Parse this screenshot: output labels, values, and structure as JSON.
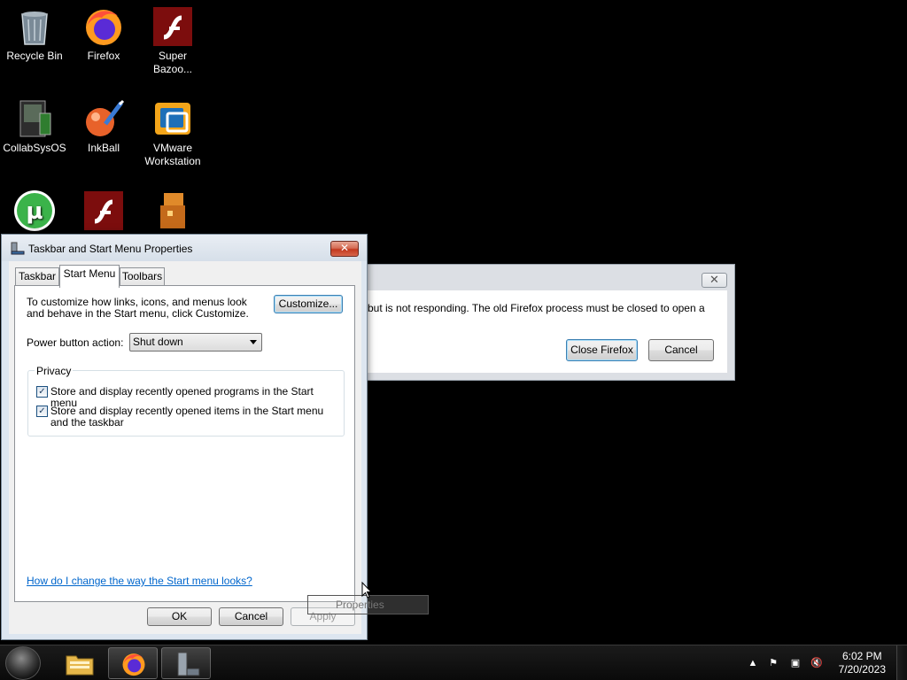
{
  "desktop": {
    "icons": [
      {
        "label": "Recycle Bin",
        "icon": "recycle-bin-icon"
      },
      {
        "label": "Firefox",
        "icon": "firefox-icon"
      },
      {
        "label": "Super Bazoo...",
        "icon": "flash-icon"
      },
      {
        "label": "CollabSysOS",
        "icon": "collabsysos-icon"
      },
      {
        "label": "InkBall",
        "icon": "inkball-icon"
      },
      {
        "label": "VMware Workstation",
        "icon": "vmware-icon"
      },
      {
        "label": "",
        "icon": "utorrent-icon"
      },
      {
        "label": "",
        "icon": "flash-icon"
      },
      {
        "label": "",
        "icon": "game-icon"
      }
    ]
  },
  "firefox_dialog": {
    "message": "but is not responding. The old Firefox process must be closed to open a",
    "close_firefox_label": "Close Firefox",
    "cancel_label": "Cancel"
  },
  "taskbar_properties": {
    "title": "Taskbar and Start Menu Properties",
    "tabs": [
      "Taskbar",
      "Start Menu",
      "Toolbars"
    ],
    "active_tab": "Start Menu",
    "description": "To customize how links, icons, and menus look and behave in the Start menu, click Customize.",
    "customize_label": "Customize...",
    "power_button_label": "Power button action:",
    "power_button_value": "Shut down",
    "privacy_group": "Privacy",
    "checkbox_programs": "Store and display recently opened programs in the Start menu",
    "checkbox_items": "Store and display recently opened items in the Start menu and the taskbar",
    "help_link": "How do I change the way the Start menu looks?",
    "ok_label": "OK",
    "cancel_label": "Cancel",
    "apply_label": "Apply"
  },
  "tooltip": {
    "text": "Properties"
  },
  "taskbar": {
    "time": "6:02 PM",
    "date": "7/20/2023",
    "pinned": [
      "file-explorer-icon",
      "firefox-icon",
      "control-panel-icon"
    ]
  }
}
